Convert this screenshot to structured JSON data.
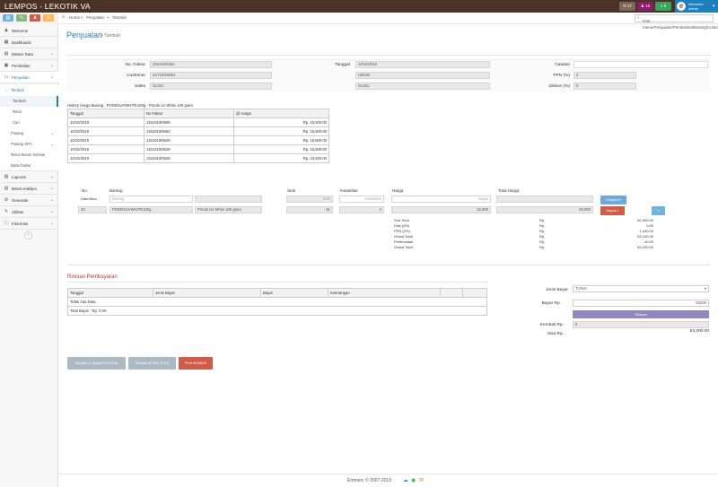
{
  "topbar": {
    "brand": "LEMPOS - LEKOTIK VA",
    "badges": [
      "17",
      "15",
      "0"
    ],
    "user_line1": "Welcome",
    "user_line2": "admin",
    "colors": {
      "bar": "#4a3324",
      "user": "#1e7fbf"
    }
  },
  "sidebar": {
    "items": [
      {
        "label": "Welcome",
        "icon": "user-icon",
        "chevron": false
      },
      {
        "label": "Dashboard",
        "icon": "dashboard-icon",
        "chevron": false
      },
      {
        "label": "Master Data",
        "icon": "database-icon",
        "chevron": true
      },
      {
        "label": "Pembelian",
        "icon": "cart-icon",
        "chevron": true
      },
      {
        "label": "Penjualan",
        "icon": "cash-icon",
        "chevron": true
      }
    ],
    "sub": {
      "tambah": "Tambah",
      "tambah2": "Tambah",
      "retur": "Retur",
      "cari": "Cari",
      "piutang": "Piutang",
      "piutang_spc": "Piutang SPC",
      "retur_belum": "Retur Belum Selesai",
      "batal": "Batal Faktur"
    },
    "items2": [
      {
        "label": "Laporan",
        "icon": "report-icon"
      },
      {
        "label": "Bisnis Intelijen",
        "icon": "chart-icon"
      },
      {
        "label": "Generate",
        "icon": "gears-icon"
      },
      {
        "label": "Utilitas",
        "icon": "wrench-icon"
      },
      {
        "label": "Informasi",
        "icon": "info-icon"
      }
    ]
  },
  "breadcrumb": {
    "home": "Home",
    "sep": ">",
    "section": "Penjualan",
    "page": "Tambah"
  },
  "search": {
    "placeholder": "Cari menu/Penjualan/Pembelian/Barang/Customer..."
  },
  "page": {
    "title": "Penjualan",
    "subtitle": "> Tambah"
  },
  "form": {
    "no_faktur_label": "No. Faktur",
    "no_faktur": "201019/4054",
    "customer_label": "Customer",
    "customer": "K2710/S0001",
    "sales_label": "Sales",
    "sales": "SLS01",
    "tanggal_label": "Tanggal",
    "tanggal": "10/10/2019",
    "cust_name": "UMUM",
    "sales_name": "SLS01",
    "catatan_label": "Catatan",
    "ppn_label": "PPN (%)",
    "ppn": "2",
    "diskon_label": "Diskon (%)",
    "diskon": "0"
  },
  "history": {
    "title": "History Harga Barang : PONDSUVWHITE100g - Ponds Uv White 100 gram",
    "headers": [
      "Tanggal",
      "No Faktur",
      "@ Harga"
    ],
    "rows": [
      [
        "10/10/2019",
        "J151019/0668",
        "Rp. 15,500.00"
      ],
      [
        "10/10/2019",
        "J151019/0663",
        "Rp. 15,500.00"
      ],
      [
        "10/10/2019",
        "J151019/0629",
        "Rp. 15,500.00"
      ],
      [
        "10/10/2019",
        "J151019/0628",
        "Rp. 15,500.00"
      ],
      [
        "10/10/2019",
        "J151019/0628",
        "Rp. 15,500.00"
      ]
    ]
  },
  "item": {
    "no_label": "No",
    "barang_label": "Barang",
    "stok_label": "Stok",
    "kwantitas_label": "Kwantitas",
    "harga_label": "Harga",
    "total_label": "Total Harga",
    "data_baru_label": "Data Baru",
    "barang_ph": "Barang",
    "stok_ph": "Stok",
    "kwantitas_ph": "Kwantitas",
    "harga_ph": "Harga",
    "row": {
      "no": "33",
      "kode": "PONDSUVWHITE100g",
      "nama": "Ponds Uv White 100 gram",
      "stok": "61",
      "qty": "4",
      "harga": "15,500",
      "total": "62,000"
    },
    "btn_simpan": "Simpan",
    "btn_hapus": "Hapus"
  },
  "totals": [
    [
      "Sub Total",
      "Rp.",
      "62,000.00"
    ],
    [
      "Disk (0%)",
      "Rp.",
      "0.00"
    ],
    [
      "PPN (2%)",
      "Rp.",
      "1,240.00"
    ],
    [
      "Grand Total",
      "Rp.",
      "63,240.00"
    ],
    [
      "Pembulatan",
      "Rp.",
      "-40.00"
    ],
    [
      "Grand Total",
      "Rp.",
      "63,200.00"
    ]
  ],
  "payment": {
    "title": "Rincian Pembayaran",
    "headers": [
      "Tanggal",
      "Jenis Bayar",
      "Bayar",
      "Keterangan"
    ],
    "empty": "Tidak Ada Data",
    "total_label": "Total Bayar : Rp.",
    "total_value": "0.00",
    "jenis_label": "Jenis Bayar",
    "jenis": "TUNAI",
    "bayar_label": "Bayar Rp.",
    "bayar": "63200",
    "btn_simpan": "Simpan",
    "kembali_label": "Kembali Rp.",
    "kembali": "0",
    "sisa_label": "Sisa Rp.",
    "sisa": "63,200.00"
  },
  "actions": {
    "b1": "Simpan & Tanpa Print (F9)",
    "b2": "Simpan & Print (F10)",
    "b3": "Print MOBILE"
  },
  "footer": {
    "text": "Emmerc © 2007-2019"
  }
}
